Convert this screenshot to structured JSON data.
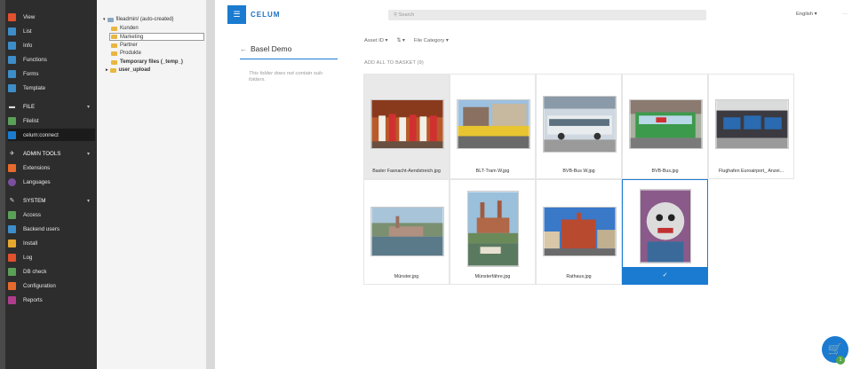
{
  "module_menu": {
    "top_items": [
      {
        "label": "View",
        "icon": "view-icon",
        "color": "#e0512d"
      },
      {
        "label": "List",
        "icon": "list-icon",
        "color": "#3c8dc8"
      },
      {
        "label": "Info",
        "icon": "info-icon",
        "color": "#3c8dc8"
      },
      {
        "label": "Functions",
        "icon": "functions-icon",
        "color": "#3c8dc8"
      },
      {
        "label": "Forms",
        "icon": "forms-icon",
        "color": "#3c8dc8"
      },
      {
        "label": "Template",
        "icon": "template-icon",
        "color": "#3c8dc8"
      }
    ],
    "file_section": "FILE",
    "file_items": [
      {
        "label": "Filelist",
        "icon": "filelist-icon",
        "color": "#5aa057"
      },
      {
        "label": "celum:connect",
        "icon": "celum-icon",
        "color": "#1a7bd0"
      }
    ],
    "admin_section": "ADMIN TOOLS",
    "admin_items": [
      {
        "label": "Extensions",
        "icon": "extensions-icon",
        "color": "#e66a2c"
      },
      {
        "label": "Languages",
        "icon": "languages-icon",
        "color": "#7b4fa0"
      }
    ],
    "system_section": "SYSTEM",
    "system_items": [
      {
        "label": "Access",
        "icon": "access-icon",
        "color": "#5aa057"
      },
      {
        "label": "Backend users",
        "icon": "backend-users-icon",
        "color": "#3c8dc8"
      },
      {
        "label": "Install",
        "icon": "install-icon",
        "color": "#e6a82c"
      },
      {
        "label": "Log",
        "icon": "log-icon",
        "color": "#e0512d"
      },
      {
        "label": "DB check",
        "icon": "db-check-icon",
        "color": "#5aa057"
      },
      {
        "label": "Configuration",
        "icon": "configuration-icon",
        "color": "#e66a2c"
      },
      {
        "label": "Reports",
        "icon": "reports-icon",
        "color": "#b03c8c"
      }
    ]
  },
  "tree": {
    "root": "fileadmin/ (auto-created)",
    "folders": [
      "Kunden",
      "Marketing",
      "Partner",
      "Produkte",
      "Temporary files (_temp_)",
      "user_upload"
    ]
  },
  "topbar": {
    "logo": "CELUM",
    "search_placeholder": "Search",
    "language": "English",
    "language_chevron": "▾",
    "more": "···"
  },
  "nav": {
    "back_arrow": "←",
    "title": "Basel Demo",
    "empty_text": "This folder does not contain sub-folders."
  },
  "filters": {
    "asset_id": "Asset ID ▾",
    "sort": "⇅ ▾",
    "file_category": "File Category ▾"
  },
  "add_all": "ADD ALL TO BASKET (9)",
  "assets": [
    {
      "caption": "Basler Fasnacht-Aendstreich.jpg"
    },
    {
      "caption": "BLT-Tram W.jpg"
    },
    {
      "caption": "BVB-Bus W.jpg"
    },
    {
      "caption": "BVB-Bus.jpg"
    },
    {
      "caption": "Flughafen Euroairport_ Anzei..."
    },
    {
      "caption": "Münster.jpg"
    },
    {
      "caption": "Münsterfähre.jpg"
    },
    {
      "caption": "Rathaus.jpg"
    },
    {
      "caption": ""
    }
  ],
  "selected_check": "✓",
  "cart": {
    "icon": "cart-icon",
    "count": "1"
  }
}
